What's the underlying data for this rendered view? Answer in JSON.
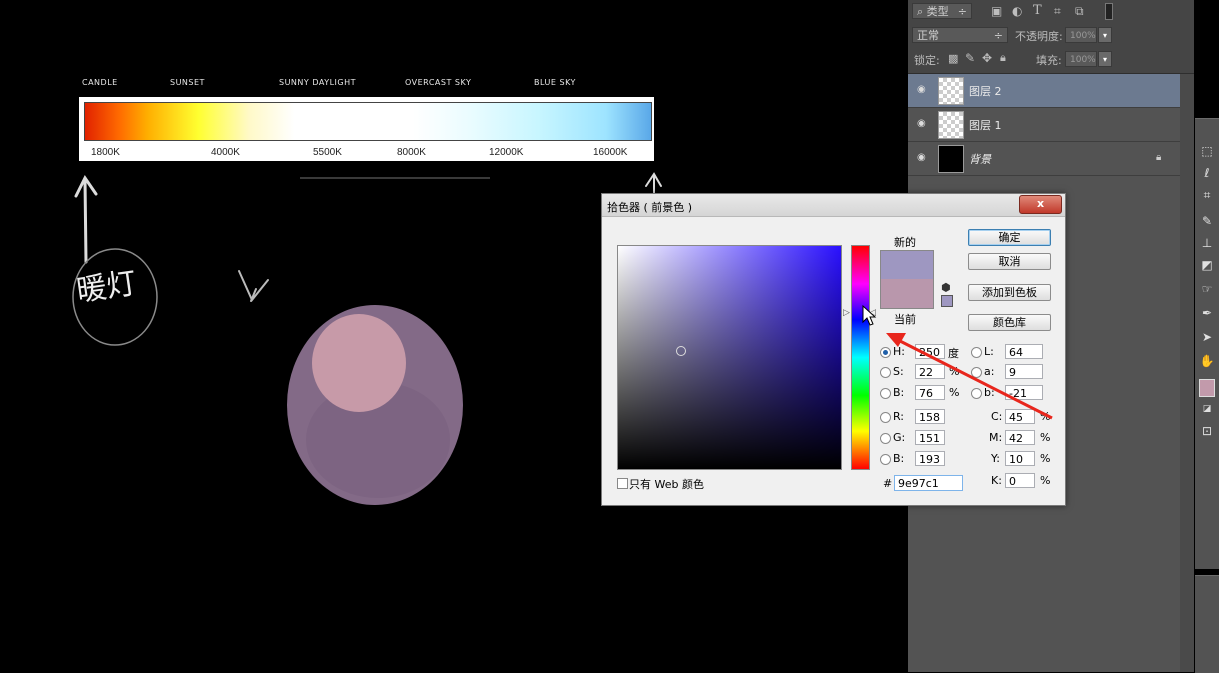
{
  "canvas": {
    "ct_labels": [
      "CANDLE",
      "SUNSET",
      "SUNNY DAYLIGHT",
      "OVERCAST SKY",
      "BLUE SKY"
    ],
    "ct_ticks": [
      "1800K",
      "4000K",
      "5500K",
      "8000K",
      "12000K",
      "16000K"
    ],
    "handwriting": "暖灯",
    "sphere_colors": {
      "outer": "#836a87",
      "inner": "#c79aa8"
    }
  },
  "layers_panel": {
    "filter_label": "类型",
    "blend_mode": "正常",
    "opacity_label": "不透明度:",
    "opacity_value": "100%",
    "lock_label": "锁定:",
    "fill_label": "填充:",
    "fill_value": "100%",
    "layers": [
      {
        "name": "图层 2",
        "selected": true,
        "thumb": "transparent"
      },
      {
        "name": "图层 1",
        "selected": false,
        "thumb": "transparent"
      },
      {
        "name": "背景",
        "selected": false,
        "thumb": "black",
        "locked": true
      }
    ]
  },
  "color_picker": {
    "title": "拾色器 ( 前景色 )",
    "close": "x",
    "new_label": "新的",
    "current_label": "当前",
    "new_color": "#9e97c1",
    "current_color": "#b997ac",
    "buttons": {
      "ok": "确定",
      "cancel": "取消",
      "add_swatch": "添加到色板",
      "libraries": "颜色库"
    },
    "hsb": {
      "h_label": "H:",
      "h": "250",
      "h_unit": "度",
      "s_label": "S:",
      "s": "22",
      "s_unit": "%",
      "b_label": "B:",
      "b": "76",
      "b_unit": "%"
    },
    "lab": {
      "l_label": "L:",
      "l": "64",
      "a_label": "a:",
      "a": "9",
      "b_label": "b:",
      "b": "-21"
    },
    "rgb": {
      "r_label": "R:",
      "r": "158",
      "g_label": "G:",
      "g": "151",
      "b_label": "B:",
      "b": "193"
    },
    "cmyk": {
      "c_label": "C:",
      "c": "45",
      "m_label": "M:",
      "m": "42",
      "y_label": "Y:",
      "y": "10",
      "k_label": "K:",
      "k": "0",
      "unit": "%"
    },
    "hex_label": "#",
    "hex": "9e97c1",
    "web_only_label": "只有 Web 颜色"
  },
  "colors": {
    "panel_bg": "#535353",
    "selected_layer": "#6c7a90",
    "annotation_arrow": "#e8261c"
  }
}
